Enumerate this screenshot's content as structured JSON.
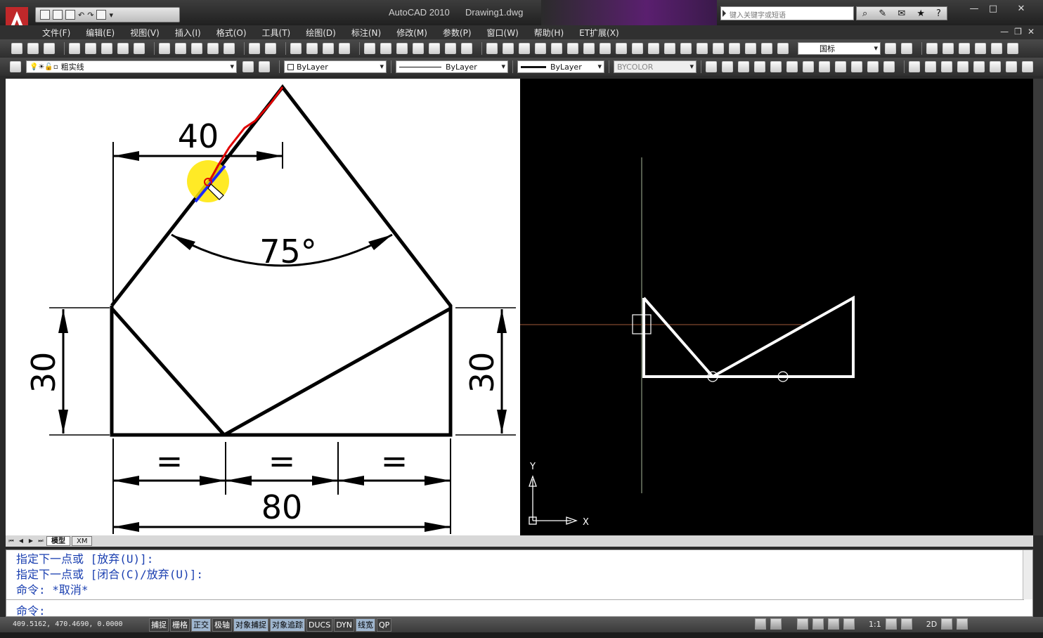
{
  "window": {
    "app_title": "AutoCAD 2010",
    "doc_title": "Drawing1.dwg",
    "search_placeholder": "键入关键字或短语"
  },
  "menus": [
    "文件(F)",
    "编辑(E)",
    "视图(V)",
    "插入(I)",
    "格式(O)",
    "工具(T)",
    "绘图(D)",
    "标注(N)",
    "修改(M)",
    "参数(P)",
    "窗口(W)",
    "帮助(H)",
    "ET扩展(X)"
  ],
  "toolbar": {
    "dim_style": "国标",
    "layer": "粗实线",
    "color": "ByLayer",
    "linetype": "ByLayer",
    "lineweight": "ByLayer",
    "plotstyle": "BYCOLOR"
  },
  "reference": {
    "dim_top": "40",
    "angle": "75°",
    "dim_left": "30",
    "dim_right": "30",
    "equal": "=",
    "dim_bottom": "80"
  },
  "ucs": {
    "x_label": "X",
    "y_label": "Y"
  },
  "layout_tabs": [
    "模型",
    "XM"
  ],
  "command": {
    "history": [
      "指定下一点或 [放弃(U)]:",
      "指定下一点或 [闭合(C)/放弃(U)]:",
      "命令: *取消*"
    ],
    "prompt": "命令:"
  },
  "status": {
    "coordinates": "409.5162, 470.4690, 0.0000",
    "toggles": [
      {
        "label": "捕捉",
        "on": false
      },
      {
        "label": "栅格",
        "on": false
      },
      {
        "label": "正交",
        "on": true
      },
      {
        "label": "极轴",
        "on": false
      },
      {
        "label": "对象捕捉",
        "on": true
      },
      {
        "label": "对象追踪",
        "on": true
      },
      {
        "label": "DUCS",
        "on": false
      },
      {
        "label": "DYN",
        "on": false
      },
      {
        "label": "线宽",
        "on": true
      },
      {
        "label": "QP",
        "on": false
      }
    ],
    "annotation_scale": "1:1",
    "workspace": "2D"
  },
  "colors": {
    "command_text": "#1a3fb0",
    "drawing_background": "#000000",
    "highlight": "#ffe600"
  }
}
